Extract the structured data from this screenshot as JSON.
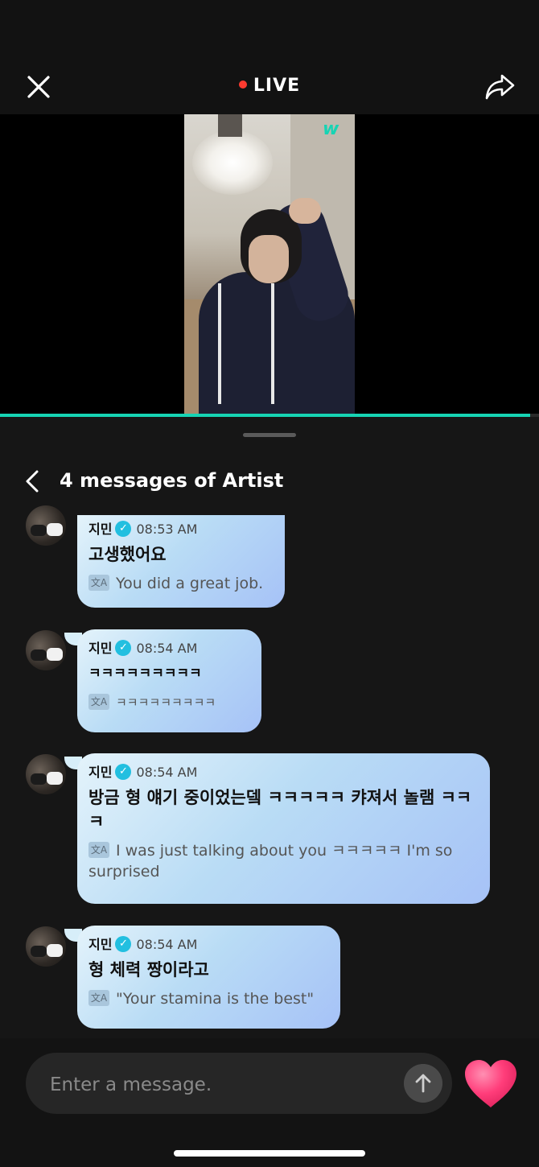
{
  "header": {
    "live_label": "LIVE",
    "accent": "#16d4b4",
    "live_dot_color": "#ff3b30"
  },
  "video": {
    "logo_text": "w",
    "progress": 0.983
  },
  "sheet": {
    "title": "4 messages of Artist"
  },
  "messages": [
    {
      "name": "지민",
      "time": "08:53 AM",
      "text": "고생했어요",
      "translation": "You did a great job."
    },
    {
      "name": "지민",
      "time": "08:54 AM",
      "text": "ㅋㅋㅋㅋㅋㅋㅋㅋㅋ",
      "translation": "ㅋㅋㅋㅋㅋㅋㅋㅋㅋ"
    },
    {
      "name": "지민",
      "time": "08:54 AM",
      "text": "방금 형 얘기 중이었는뎈 ㅋㅋㅋㅋㅋ 캬져서 놀램 ㅋㅋㅋ",
      "translation": "I was just talking about you ㅋㅋㅋㅋㅋ I'm so surprised"
    },
    {
      "name": "지민",
      "time": "08:54 AM",
      "text": "형 체력 짱이라고",
      "translation": "\"Your stamina is the best\""
    }
  ],
  "composer": {
    "placeholder": "Enter a message.",
    "heart_color": "#ff3d7a"
  }
}
